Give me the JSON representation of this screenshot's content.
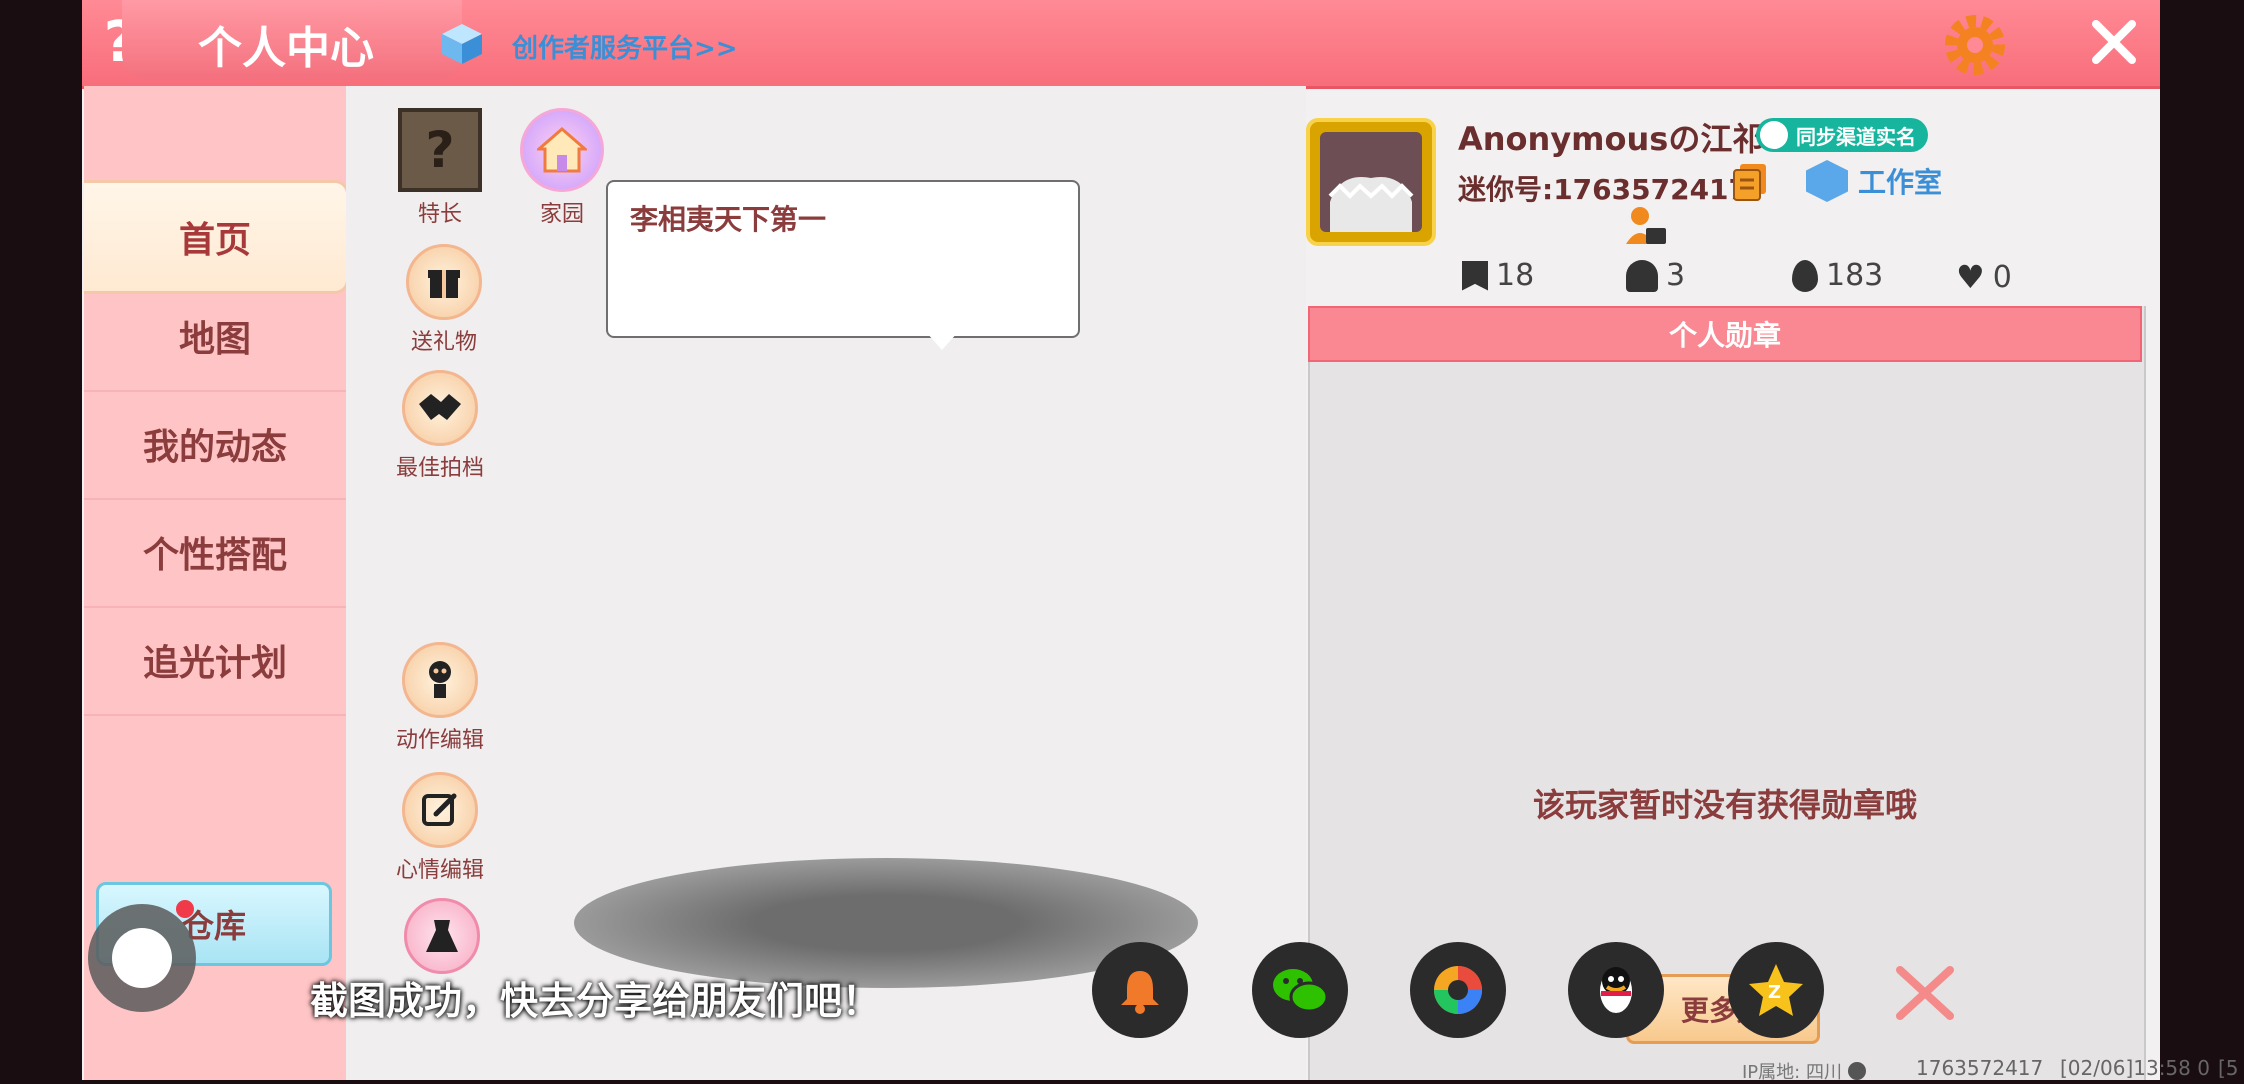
{
  "header": {
    "help_icon": "question-icon",
    "title": "个人中心",
    "creator_link": "创作者服务平台>>",
    "settings_icon": "gear-icon",
    "close_icon": "close-icon"
  },
  "sidebar": {
    "items": [
      {
        "label": "首页",
        "active": true
      },
      {
        "label": "地图"
      },
      {
        "label": "我的动态"
      },
      {
        "label": "个性搭配"
      },
      {
        "label": "追光计划"
      }
    ],
    "warehouse_label": "仓库"
  },
  "actions": {
    "specialty": "特长",
    "home": "家园",
    "gift": "送礼物",
    "partner": "最佳拍档",
    "action_edit": "动作编辑",
    "mood_edit": "心情编辑"
  },
  "bubble_text": "李相夷天下第一",
  "profile": {
    "name": "Anonymousの江祁.",
    "sync_badge": "同步渠道实名",
    "mini_id": "迷你号:1763572417",
    "studio": "工作室"
  },
  "stats": [
    {
      "icon": "plus-bookmark-icon",
      "value": "18"
    },
    {
      "icon": "fans-icon",
      "value": "3"
    },
    {
      "icon": "fire-icon",
      "value": "183"
    },
    {
      "icon": "heart-icon",
      "value": "0"
    }
  ],
  "medals": {
    "header": "个人勋章",
    "empty_text": "该玩家暂时没有获得勋章哦",
    "more_button": "更多勋"
  },
  "share": {
    "toast": "截图成功，快去分享给朋友们吧！"
  },
  "footer": {
    "ip": "IP属地: 四川",
    "id": "1763572417",
    "time": "[02/06]13:58 0",
    "extra": "[5"
  },
  "colors": {
    "topbar": "#f86e7b",
    "sidebar": "#ffc4c5",
    "accent_text": "#8b3c3c",
    "medal_header": "#f98893"
  }
}
